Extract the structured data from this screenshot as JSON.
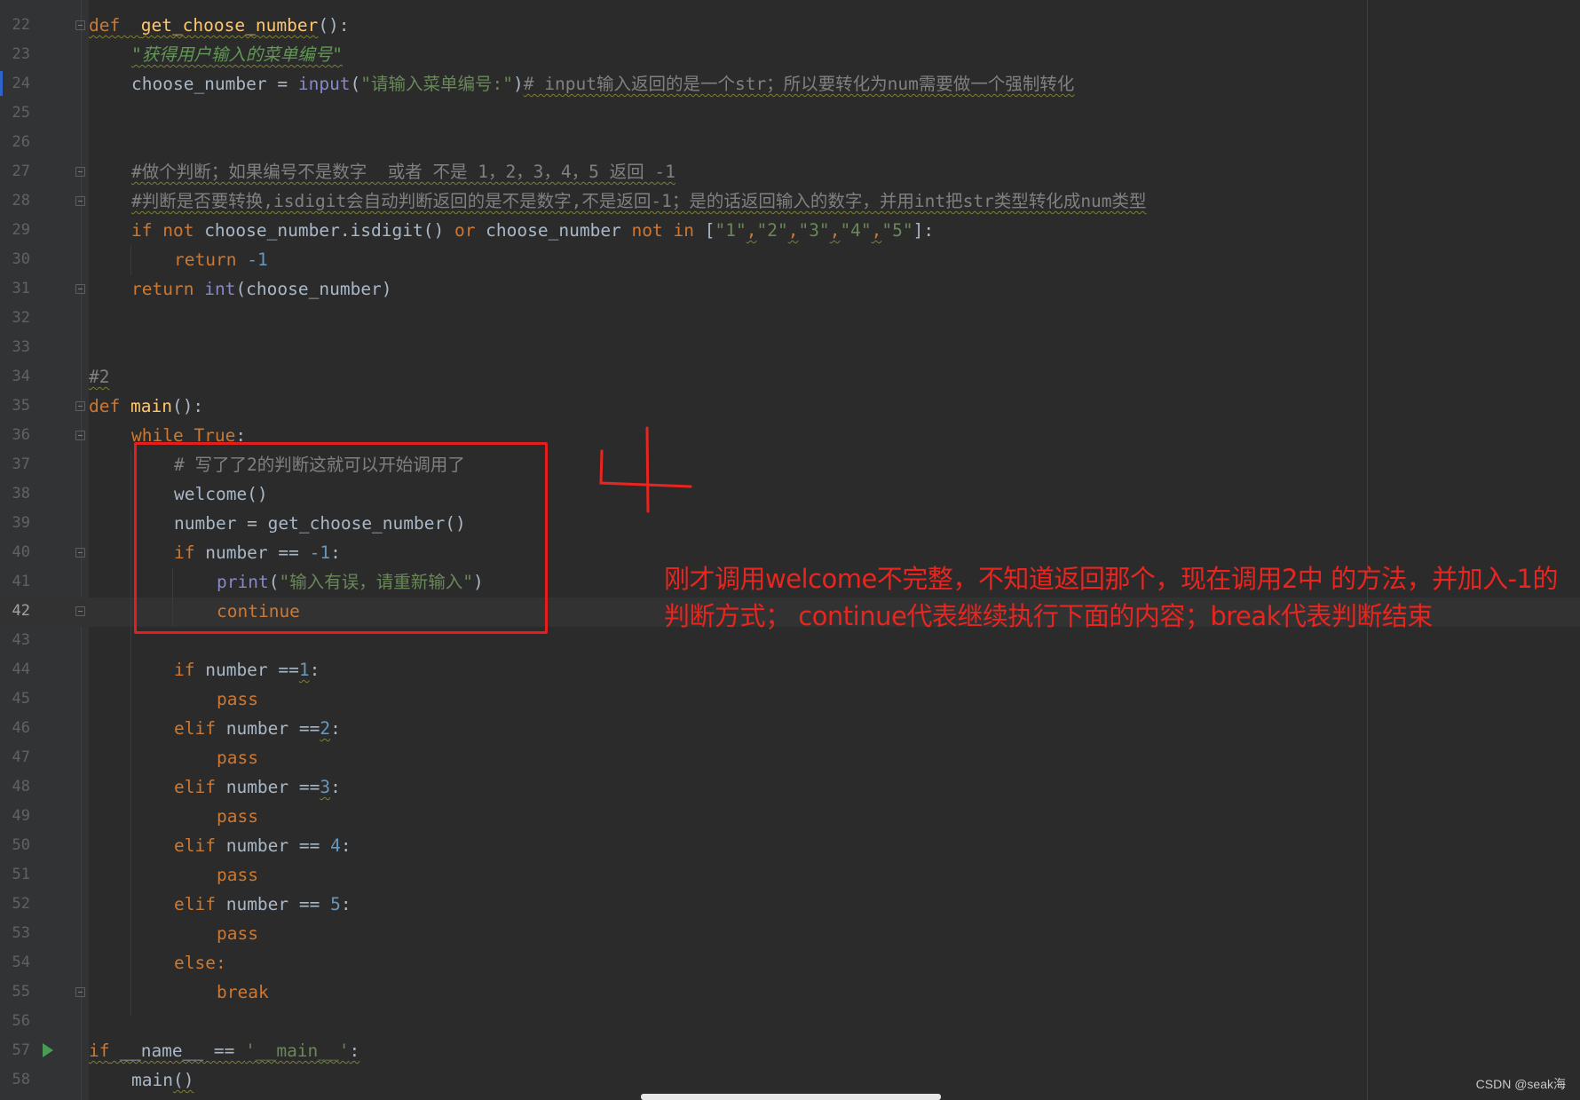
{
  "editor": {
    "current_line": "42",
    "lines": [
      {
        "n": "22",
        "text": "def  get_choose_number():"
      },
      {
        "n": "23",
        "text": "\"获得用户输入的菜单编号\""
      },
      {
        "n": "24",
        "text": "choose_number = input(\"请输入菜单编号:\")# input输入返回的是一个str；所以要转化为num需要做一个强制转化"
      },
      {
        "n": "25",
        "text": ""
      },
      {
        "n": "26",
        "text": ""
      },
      {
        "n": "27",
        "text": "#做个判断；如果编号不是数字  或者 不是 1，2，3，4，5 返回 -1"
      },
      {
        "n": "28",
        "text": "#判断是否要转换,isdigit会自动判断返回的是不是数字,不是返回-1；是的话返回输入的数字，并用int把str类型转化成num类型"
      },
      {
        "n": "29",
        "text": "if not choose_number.isdigit() or choose_number not in [\"1\",\"2\",\"3\",\"4\",\"5\"]:"
      },
      {
        "n": "30",
        "text": "return -1"
      },
      {
        "n": "31",
        "text": "return int(choose_number)"
      },
      {
        "n": "32",
        "text": ""
      },
      {
        "n": "33",
        "text": ""
      },
      {
        "n": "34",
        "text": "#2"
      },
      {
        "n": "35",
        "text": "def main():"
      },
      {
        "n": "36",
        "text": "while True:"
      },
      {
        "n": "37",
        "text": "# 写了了2的判断这就可以开始调用了"
      },
      {
        "n": "38",
        "text": "welcome()"
      },
      {
        "n": "39",
        "text": "number = get_choose_number()"
      },
      {
        "n": "40",
        "text": "if number == -1:"
      },
      {
        "n": "41",
        "text": "print(\"输入有误，请重新输入\")"
      },
      {
        "n": "42",
        "text": "continue"
      },
      {
        "n": "43",
        "text": ""
      },
      {
        "n": "44",
        "text": "if number ==1:"
      },
      {
        "n": "45",
        "text": "pass"
      },
      {
        "n": "46",
        "text": "elif number ==2:"
      },
      {
        "n": "47",
        "text": "pass"
      },
      {
        "n": "48",
        "text": "elif number ==3:"
      },
      {
        "n": "49",
        "text": "pass"
      },
      {
        "n": "50",
        "text": "elif number == 4:"
      },
      {
        "n": "51",
        "text": "pass"
      },
      {
        "n": "52",
        "text": "elif number == 5:"
      },
      {
        "n": "53",
        "text": "pass"
      },
      {
        "n": "54",
        "text": "else:"
      },
      {
        "n": "55",
        "text": "break"
      },
      {
        "n": "56",
        "text": ""
      },
      {
        "n": "57",
        "text": "if __name__ == '__main__':"
      },
      {
        "n": "58",
        "text": "main()"
      }
    ]
  },
  "annotation": {
    "handwritten_mark": "4",
    "note": "刚才调用welcome不完整，不知道返回那个，现在调用2中 的方法，并加入-1的判断方式； continue代表继续执行下面的内容；break代表判断结束",
    "color": "#e8251f"
  },
  "watermark": "CSDN @seak海",
  "icons": {
    "fold": "fold-marker-icon",
    "run": "run-gutter-icon"
  }
}
